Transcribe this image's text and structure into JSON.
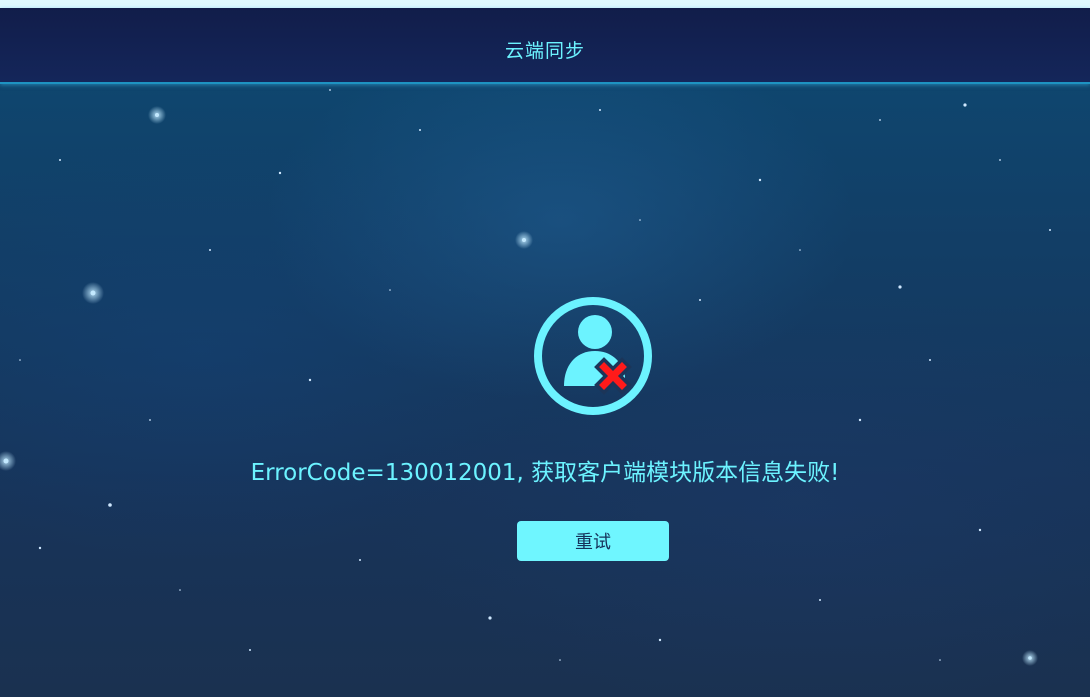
{
  "window": {
    "title": "云端同步"
  },
  "error": {
    "icon": "user-error-icon",
    "message": "ErrorCode=130012001, 获取客户端模块版本信息失败!"
  },
  "actions": {
    "retry_label": "重试"
  },
  "colors": {
    "accent": "#6cf3ff",
    "button_bg": "#6ff6ff",
    "error_mark": "#ff1a1a"
  }
}
